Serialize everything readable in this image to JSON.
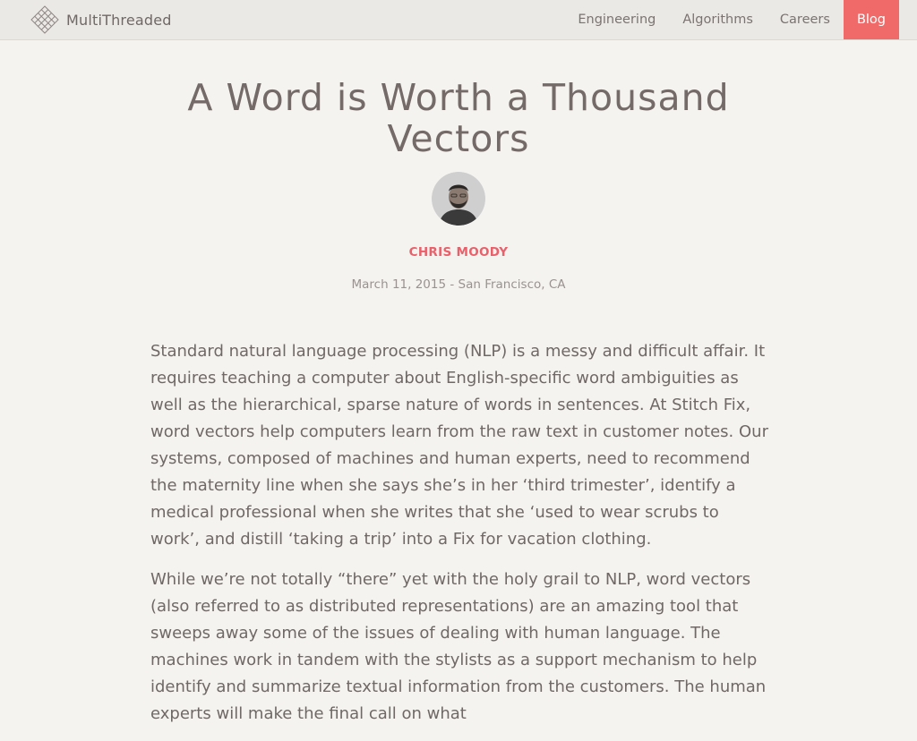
{
  "site": {
    "name": "MultiThreaded",
    "logo_icon": "diamond-lattice-icon"
  },
  "nav": {
    "items": [
      {
        "label": "Engineering",
        "active": false
      },
      {
        "label": "Algorithms",
        "active": false
      },
      {
        "label": "Careers",
        "active": false
      },
      {
        "label": "Blog",
        "active": true
      }
    ]
  },
  "post": {
    "title": "A Word is Worth a Thousand Vectors",
    "author": "CHRIS MOODY",
    "meta": "March 11, 2015 - San Francisco, CA",
    "paragraphs": [
      "Standard natural language processing (NLP) is a messy and difficult affair. It requires teaching a computer about English-specific word ambiguities as well as the hierarchical, sparse nature of words in sentences. At Stitch Fix, word vectors help computers learn from the raw text in customer notes. Our systems, composed of machines and human experts, need to recommend the maternity line when she says she’s in her ‘third trimester’, identify a medical professional when she writes that she ‘used to wear scrubs to work’, and distill ‘taking a trip’ into a Fix for vacation clothing.",
      "While we’re not totally “there” yet with the holy grail to NLP, word vectors (also referred to as distributed representations) are an amazing tool that sweeps away some of the issues of dealing with human language. The machines work in tandem with the stylists as a support mechanism to help identify and summarize textual information from the customers. The human experts will make the final call on what"
    ]
  },
  "colors": {
    "accent": "#f06a6a",
    "author": "#e9606a",
    "background": "#f5f3f0",
    "navbar": "#ebe9e6"
  }
}
